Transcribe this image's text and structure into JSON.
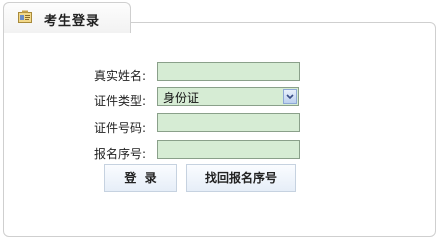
{
  "panel": {
    "title": "考生登录"
  },
  "form": {
    "name_label": "真实姓名:",
    "name_value": "",
    "id_type_label": "证件类型:",
    "id_type_selected": "身份证",
    "id_number_label": "证件号码:",
    "id_number_value": "",
    "reg_number_label": "报名序号:",
    "reg_number_value": ""
  },
  "buttons": {
    "login_label": "登  录",
    "recover_label": "找回报名序号"
  },
  "colors": {
    "field_background": "#d6ecd4",
    "field_border": "#8aa08a"
  }
}
